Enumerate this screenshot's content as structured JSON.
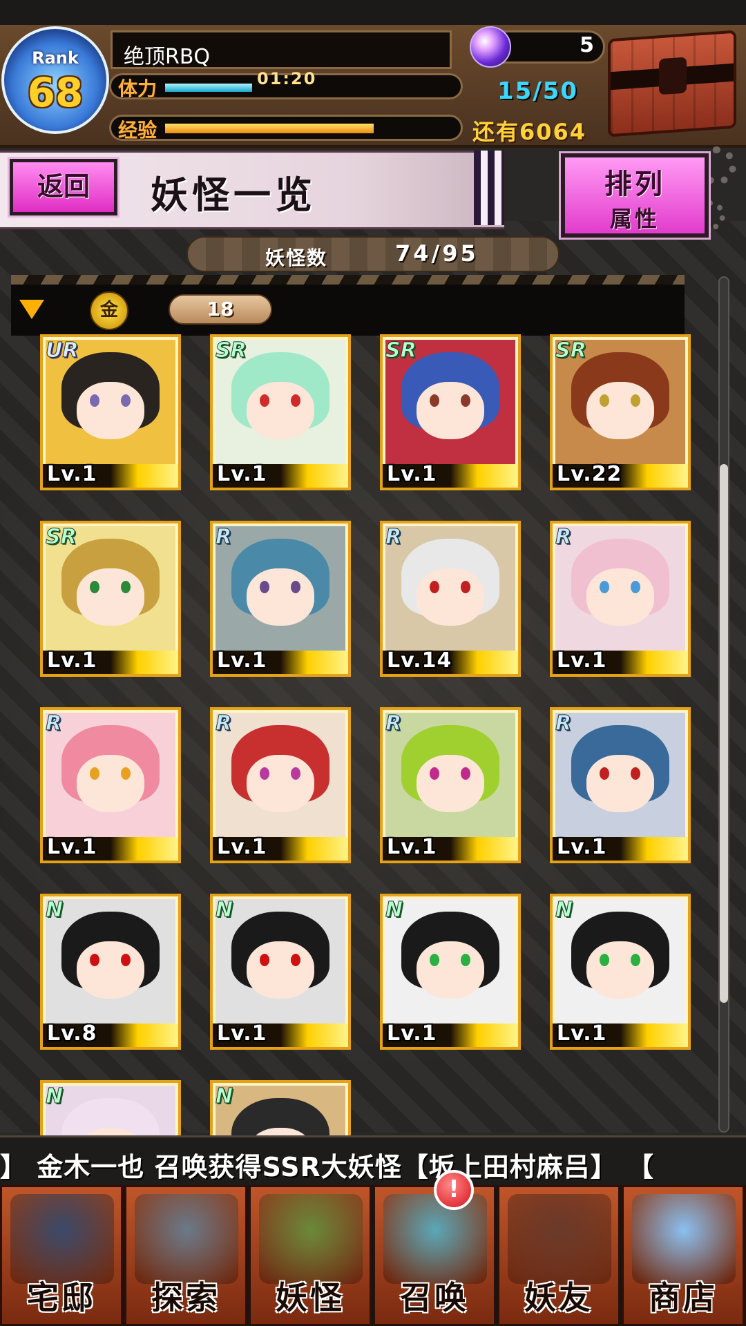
{
  "header": {
    "rank_label": "Rank",
    "rank_value": "68",
    "player_name": "绝顶RBQ",
    "stamina_label": "体力",
    "stamina_timer": "01:20",
    "stamina_value": "15/50",
    "stamina_fraction": 0.3,
    "exp_label": "经验",
    "exp_remaining": "还有6064",
    "exp_fraction": 0.72,
    "orb_count": "5",
    "icons": {
      "orb": "crystal-orb-icon",
      "chest": "treasure-chest-icon"
    }
  },
  "title_bar": {
    "back_label": "返回",
    "title": "妖怪一览",
    "sort_label": "排列",
    "sort_value": "属性"
  },
  "summary": {
    "count_label": "妖怪数",
    "count_value": "74/95"
  },
  "filter": {
    "icon_glyph": "金",
    "level_value": "18"
  },
  "cards": [
    {
      "rarity": "UR",
      "level": "Lv.1",
      "hair": "#2a2420",
      "eyes": "#7a68b0",
      "bg": "#f0c040"
    },
    {
      "rarity": "SR",
      "level": "Lv.1",
      "hair": "#9fe8c8",
      "eyes": "#d02a2a",
      "bg": "#e8f0e0"
    },
    {
      "rarity": "SR",
      "level": "Lv.1",
      "hair": "#3a5ab8",
      "eyes": "#8a3a2a",
      "bg": "#c03040"
    },
    {
      "rarity": "SR",
      "level": "Lv.22",
      "hair": "#8a3a1a",
      "eyes": "#c0a030",
      "bg": "#c88a4a"
    },
    {
      "rarity": "SR",
      "level": "Lv.1",
      "hair": "#c8a040",
      "eyes": "#2a8a3a",
      "bg": "#f0e090"
    },
    {
      "rarity": "R",
      "level": "Lv.1",
      "hair": "#4a8aa8",
      "eyes": "#6a4a8a",
      "bg": "#9aa8a8"
    },
    {
      "rarity": "R",
      "level": "Lv.14",
      "hair": "#e8e8e8",
      "eyes": "#c02020",
      "bg": "#d8c8a8"
    },
    {
      "rarity": "R",
      "level": "Lv.1",
      "hair": "#f0c0d0",
      "eyes": "#4a9ad8",
      "bg": "#f0d8e0"
    },
    {
      "rarity": "R",
      "level": "Lv.1",
      "hair": "#f08aa0",
      "eyes": "#e8a020",
      "bg": "#f8d0d8"
    },
    {
      "rarity": "R",
      "level": "Lv.1",
      "hair": "#c83030",
      "eyes": "#b83aa0",
      "bg": "#f0e0d0"
    },
    {
      "rarity": "R",
      "level": "Lv.1",
      "hair": "#a0d030",
      "eyes": "#c02a8a",
      "bg": "#c8d8a0"
    },
    {
      "rarity": "R",
      "level": "Lv.1",
      "hair": "#3a6a9a",
      "eyes": "#c02020",
      "bg": "#c8d0e0"
    },
    {
      "rarity": "N",
      "level": "Lv.8",
      "hair": "#1a1a1a",
      "eyes": "#d01010",
      "bg": "#e0e0e0"
    },
    {
      "rarity": "N",
      "level": "Lv.1",
      "hair": "#1a1a1a",
      "eyes": "#d01010",
      "bg": "#e0e0e0"
    },
    {
      "rarity": "N",
      "level": "Lv.1",
      "hair": "#1a1a1a",
      "eyes": "#2ab040",
      "bg": "#f0f0f0"
    },
    {
      "rarity": "N",
      "level": "Lv.1",
      "hair": "#1a1a1a",
      "eyes": "#2ab040",
      "bg": "#f0f0f0"
    },
    {
      "rarity": "N",
      "level": "",
      "hair": "#f0e0f0",
      "eyes": "#a08ad0",
      "bg": "#e8d8e8"
    },
    {
      "rarity": "N",
      "level": "",
      "hair": "#2a2a2a",
      "eyes": "#6a4a2a",
      "bg": "#d8b880"
    }
  ],
  "ticker": {
    "text": "】   金木一也 召唤获得SSR大妖怪【坂上田村麻吕】   【"
  },
  "nav": [
    {
      "label": "宅邸",
      "icon": "mansion-icon",
      "art": "#3a4a6a"
    },
    {
      "label": "探索",
      "icon": "magnifier-icon",
      "art": "#6a7a8a"
    },
    {
      "label": "妖怪",
      "icon": "scroll-icon",
      "art": "#6a8a3a"
    },
    {
      "label": "召唤",
      "icon": "pentagram-icon",
      "art": "#5aa8b8"
    },
    {
      "label": "妖友",
      "icon": "fox-girl-icon",
      "art": "#6a3a2a"
    },
    {
      "label": "商店",
      "icon": "crystal-ball-icon",
      "art": "#8ac0f0"
    }
  ],
  "notify_badge": "!",
  "colors": {
    "accent_pink": "#e23ccc",
    "gold": "#e6a216",
    "cyan": "#38d8ff"
  }
}
